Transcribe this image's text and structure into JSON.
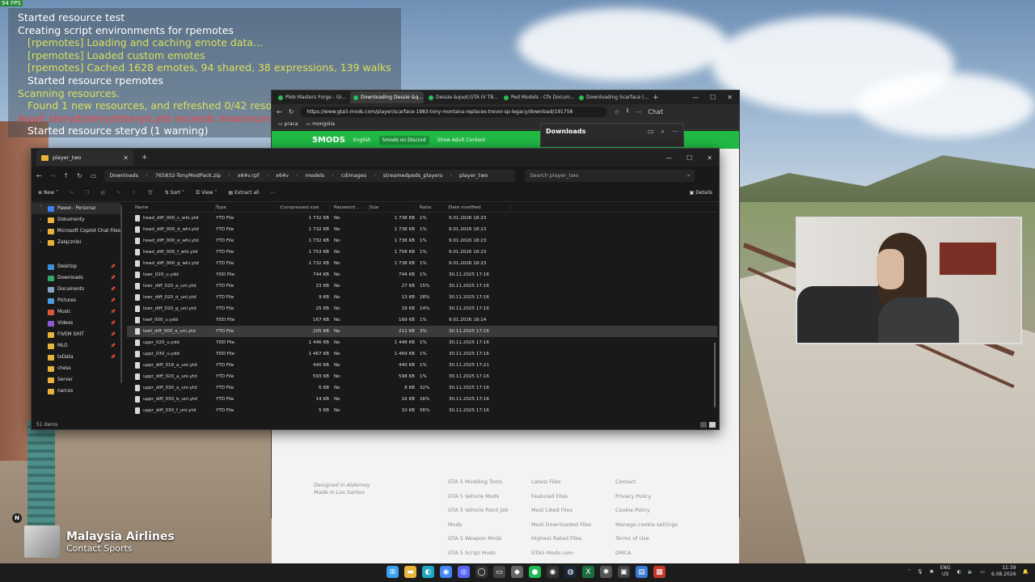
{
  "overlay": {
    "fps": "94 FPS",
    "console_lines": [
      {
        "text": "Started resource test",
        "color": "white",
        "indent": false
      },
      {
        "text": "Creating script environments for rpemotes",
        "color": "white",
        "indent": false
      },
      {
        "text": "[rpemotes] Loading and caching emote data...",
        "color": "yellow",
        "indent": true
      },
      {
        "text": "[rpemotes] Loaded custom emotes",
        "color": "yellow",
        "indent": true
      },
      {
        "text": "[rpemotes] Cached 1628 emotes, 94 shared, 38 expressions, 139 walks",
        "color": "yellow",
        "indent": true
      },
      {
        "text": "Started resource rpemotes",
        "color": "white",
        "indent": true
      },
      {
        "text": "Scanning resources.",
        "color": "yellow",
        "indent": false
      },
      {
        "text": "Found 1 new resources, and refreshed 0/42 resources",
        "color": "yellow",
        "indent": true
      },
      {
        "text": "Asset steryd/stery/dsteryd.ytd exceeds maximum memory",
        "color": "red",
        "indent": false
      },
      {
        "text": "Started resource steryd (1 warning)",
        "color": "white",
        "indent": true
      }
    ]
  },
  "browser": {
    "tabs": [
      {
        "label": "Pleb Masters Forge - Gi...",
        "active": false
      },
      {
        "label": "Downloading Dessie &q...",
        "active": true
      },
      {
        "label": "Dessie &quot;GTA IV TB...",
        "active": false
      },
      {
        "label": "Ped Models - Cfx Docum...",
        "active": false
      },
      {
        "label": "Downloading Scarface (...",
        "active": false
      }
    ],
    "url": "https://www.gta5-mods.com/player/scarface-1983-tony-montana-replaces-trevor-sp-legacy/download/191758",
    "chat_label": "Chat",
    "bookmarks": [
      "praca",
      "mongolia"
    ],
    "downloads_title": "Downloads",
    "site_logo": "5MODS",
    "site_bar": [
      "English",
      "5mods on Discord",
      "Show Adult Content"
    ],
    "footer_left": [
      "Designed in Alderney",
      "Made in Los Santos"
    ],
    "footer_cols": [
      [
        "GTA 5 Modding Tools",
        "GTA 5 Vehicle Mods",
        "GTA 5 Vehicle Paint Job",
        "Mods",
        "GTA 5 Weapon Mods",
        "GTA 5 Script Mods"
      ],
      [
        "Latest Files",
        "Featured Files",
        "Most Liked Files",
        "Most Downloaded Files",
        "Highest Rated Files",
        "GTA5 Mods.com"
      ],
      [
        "Contact",
        "Privacy Policy",
        "Cookie Policy",
        "Manage cookie settings",
        "Terms of Use",
        "DMCA"
      ]
    ]
  },
  "explorer": {
    "tab_title": "player_two",
    "breadcrumb": [
      "Downloads",
      "765832-TonyModPack.zip",
      "x64v.rpf",
      "x64v",
      "models",
      "cdimages",
      "streamedpeds_players",
      "player_two"
    ],
    "search_placeholder": "Search player_two",
    "commands": {
      "new": "New",
      "sort": "Sort",
      "view": "View",
      "extract": "Extract all",
      "details": "Details"
    },
    "sidebar": [
      {
        "label": "Paweł - Personal",
        "icon": "cloud",
        "color": "#3b82f6",
        "pin": false,
        "selected": true
      },
      {
        "label": "Dokumenty",
        "icon": "folder",
        "color": "#e8b43c",
        "pin": false,
        "selected": false
      },
      {
        "label": "Microsoft Copilot Chat Files",
        "icon": "folder",
        "color": "#e8b43c",
        "pin": false,
        "selected": false
      },
      {
        "label": "Załączniki",
        "icon": "folder",
        "color": "#e8b43c",
        "pin": false,
        "selected": false
      },
      {
        "label": "",
        "icon": "gap",
        "color": "",
        "pin": false,
        "selected": false
      },
      {
        "label": "Desktop",
        "icon": "desktop",
        "color": "#3a8fd8",
        "pin": true,
        "selected": false
      },
      {
        "label": "Downloads",
        "icon": "download",
        "color": "#2fa86a",
        "pin": true,
        "selected": false
      },
      {
        "label": "Documents",
        "icon": "document",
        "color": "#8aa4c8",
        "pin": true,
        "selected": false
      },
      {
        "label": "Pictures",
        "icon": "picture",
        "color": "#4b9be0",
        "pin": true,
        "selected": false
      },
      {
        "label": "Music",
        "icon": "music",
        "color": "#e0573d",
        "pin": true,
        "selected": false
      },
      {
        "label": "Videos",
        "icon": "video",
        "color": "#8a5ad8",
        "pin": true,
        "selected": false
      },
      {
        "label": "FIVEM SHIT",
        "icon": "folder",
        "color": "#e8b43c",
        "pin": true,
        "selected": false
      },
      {
        "label": "MLO",
        "icon": "folder",
        "color": "#e8b43c",
        "pin": true,
        "selected": false
      },
      {
        "label": "txData",
        "icon": "folder",
        "color": "#e8b43c",
        "pin": true,
        "selected": false
      },
      {
        "label": "chess",
        "icon": "folder",
        "color": "#e8b43c",
        "pin": false,
        "selected": false
      },
      {
        "label": "Server",
        "icon": "folder",
        "color": "#e8b43c",
        "pin": false,
        "selected": false
      },
      {
        "label": "narcos",
        "icon": "folder",
        "color": "#e8b43c",
        "pin": false,
        "selected": false
      }
    ],
    "columns": [
      "Name",
      "Type",
      "Compressed size",
      "Password ...",
      "Size",
      "Ratio",
      "Date modified"
    ],
    "rows": [
      {
        "name": "head_diff_000_c_whi.ytd",
        "type": "YTD File",
        "comp": "1 732 KB",
        "pw": "No",
        "size": "1 738 KB",
        "ratio": "1%",
        "date": "9.01.2026 18:23"
      },
      {
        "name": "head_diff_000_d_whi.ytd",
        "type": "YTD File",
        "comp": "1 732 KB",
        "pw": "No",
        "size": "1 738 KB",
        "ratio": "1%",
        "date": "9.01.2026 18:23"
      },
      {
        "name": "head_diff_000_e_whi.ytd",
        "type": "YTD File",
        "comp": "1 732 KB",
        "pw": "No",
        "size": "1 738 KB",
        "ratio": "1%",
        "date": "9.01.2026 18:23"
      },
      {
        "name": "head_diff_000_f_whi.ytd",
        "type": "YTD File",
        "comp": "1 753 KB",
        "pw": "No",
        "size": "1 758 KB",
        "ratio": "1%",
        "date": "9.01.2026 18:23"
      },
      {
        "name": "head_diff_000_g_whi.ytd",
        "type": "YTD File",
        "comp": "1 732 KB",
        "pw": "No",
        "size": "1 738 KB",
        "ratio": "1%",
        "date": "9.01.2026 18:23"
      },
      {
        "name": "lowr_020_u.ydd",
        "type": "YDD File",
        "comp": "744 KB",
        "pw": "No",
        "size": "744 KB",
        "ratio": "1%",
        "date": "30.11.2025 17:16"
      },
      {
        "name": "lowr_diff_020_a_uni.ytd",
        "type": "YTD File",
        "comp": "23 KB",
        "pw": "No",
        "size": "27 KB",
        "ratio": "15%",
        "date": "30.11.2025 17:16"
      },
      {
        "name": "lowr_diff_020_d_uni.ytd",
        "type": "YTD File",
        "comp": "9 KB",
        "pw": "No",
        "size": "13 KB",
        "ratio": "28%",
        "date": "30.11.2025 17:16"
      },
      {
        "name": "lowr_diff_020_g_uni.ytd",
        "type": "YTD File",
        "comp": "25 KB",
        "pw": "No",
        "size": "29 KB",
        "ratio": "14%",
        "date": "30.11.2025 17:16"
      },
      {
        "name": "teef_000_u.ydd",
        "type": "YDD File",
        "comp": "167 KB",
        "pw": "No",
        "size": "169 KB",
        "ratio": "1%",
        "date": "9.01.2026 18:14"
      },
      {
        "name": "teef_diff_000_a_uni.ytd",
        "type": "YTD File",
        "comp": "205 KB",
        "pw": "No",
        "size": "211 KB",
        "ratio": "3%",
        "date": "30.11.2025 17:16",
        "highlight": true
      },
      {
        "name": "uppr_020_u.ydd",
        "type": "YDD File",
        "comp": "1 446 KB",
        "pw": "No",
        "size": "1 448 KB",
        "ratio": "1%",
        "date": "30.11.2025 17:16"
      },
      {
        "name": "uppr_030_u.ydd",
        "type": "YDD File",
        "comp": "1 467 KB",
        "pw": "No",
        "size": "1 469 KB",
        "ratio": "1%",
        "date": "30.11.2025 17:16"
      },
      {
        "name": "uppr_diff_016_a_uni.ytd",
        "type": "YTD File",
        "comp": "440 KB",
        "pw": "No",
        "size": "440 KB",
        "ratio": "1%",
        "date": "30.11.2025 17:21"
      },
      {
        "name": "uppr_diff_020_a_uni.ytd",
        "type": "YTD File",
        "comp": "593 KB",
        "pw": "No",
        "size": "598 KB",
        "ratio": "1%",
        "date": "30.11.2025 17:16"
      },
      {
        "name": "uppr_diff_030_a_uni.ytd",
        "type": "YTD File",
        "comp": "6 KB",
        "pw": "No",
        "size": "8 KB",
        "ratio": "32%",
        "date": "30.11.2025 17:16"
      },
      {
        "name": "uppr_diff_030_b_uni.ytd",
        "type": "YTD File",
        "comp": "14 KB",
        "pw": "No",
        "size": "16 KB",
        "ratio": "16%",
        "date": "30.11.2025 17:16"
      },
      {
        "name": "uppr_diff_030_f_uni.ytd",
        "type": "YTD File",
        "comp": "5 KB",
        "pw": "No",
        "size": "10 KB",
        "ratio": "56%",
        "date": "30.11.2025 17:16"
      }
    ],
    "status": "51 items"
  },
  "now_playing": {
    "title": "Malaysia Airlines",
    "subtitle": "Contact Sports",
    "badge": "N"
  },
  "taskbar": {
    "apps": [
      {
        "name": "start",
        "color": "#3aa0f0",
        "glyph": "⊞"
      },
      {
        "name": "file-explorer",
        "color": "#e8b43c",
        "glyph": "▬"
      },
      {
        "name": "edge",
        "color": "#1ea7c4",
        "glyph": "◐"
      },
      {
        "name": "chrome",
        "color": "#4285f4",
        "glyph": "◉"
      },
      {
        "name": "discord",
        "color": "#5865f2",
        "glyph": "◎"
      },
      {
        "name": "github",
        "color": "#333333",
        "glyph": "◯"
      },
      {
        "name": "terminal",
        "color": "#444444",
        "glyph": "▭"
      },
      {
        "name": "unity",
        "color": "#666666",
        "glyph": "◆"
      },
      {
        "name": "spotify",
        "color": "#1db954",
        "glyph": "●"
      },
      {
        "name": "obs",
        "color": "#333333",
        "glyph": "◉"
      },
      {
        "name": "steam",
        "color": "#1b2838",
        "glyph": "◍"
      },
      {
        "name": "excel",
        "color": "#1d6f42",
        "glyph": "X"
      },
      {
        "name": "app-tool",
        "color": "#555555",
        "glyph": "✱"
      },
      {
        "name": "app-window",
        "color": "#444444",
        "glyph": "▣"
      },
      {
        "name": "notepad",
        "color": "#3a7bd5",
        "glyph": "▤"
      },
      {
        "name": "app-red",
        "color": "#c0392b",
        "glyph": "▦"
      }
    ],
    "lang": "ENG",
    "region": "US",
    "time": "11:39",
    "date": "6.08.2026"
  }
}
